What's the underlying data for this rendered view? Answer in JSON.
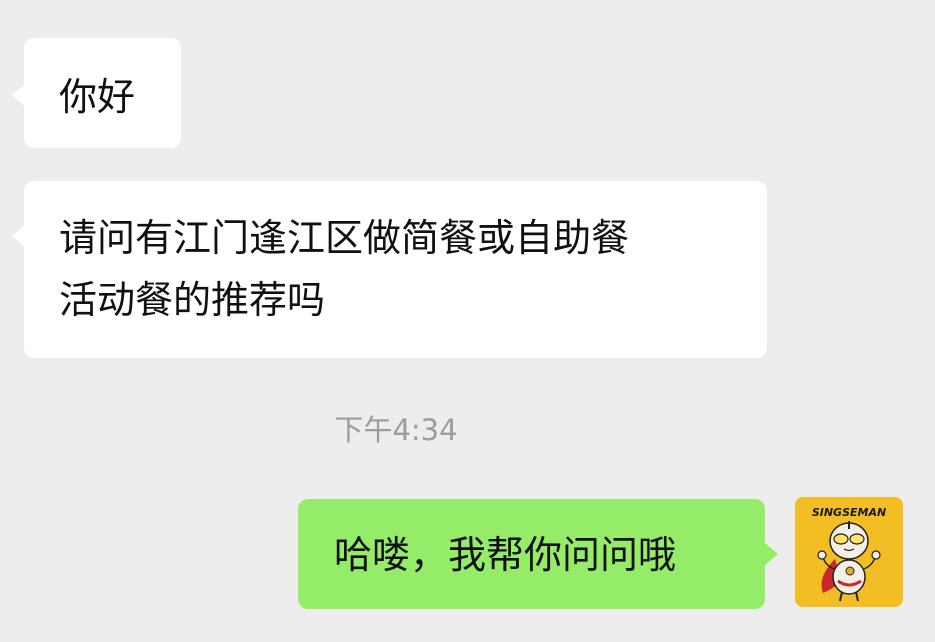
{
  "messages": [
    {
      "direction": "incoming",
      "text": "你好"
    },
    {
      "direction": "incoming",
      "text": "请问有江门逢江区做简餐或自助餐\n活动餐的推荐吗"
    },
    {
      "direction": "outgoing",
      "text": "哈喽，我帮你问问哦"
    }
  ],
  "timestamp": "下午4:34",
  "avatar": {
    "label": "SINGSEMAN",
    "icon": "cartoon-hero-avatar"
  },
  "colors": {
    "background": "#ededed",
    "incoming_bubble": "#ffffff",
    "outgoing_bubble": "#95ec69",
    "timestamp_text": "#9c9c9c",
    "avatar_background": "#f3bd24"
  }
}
